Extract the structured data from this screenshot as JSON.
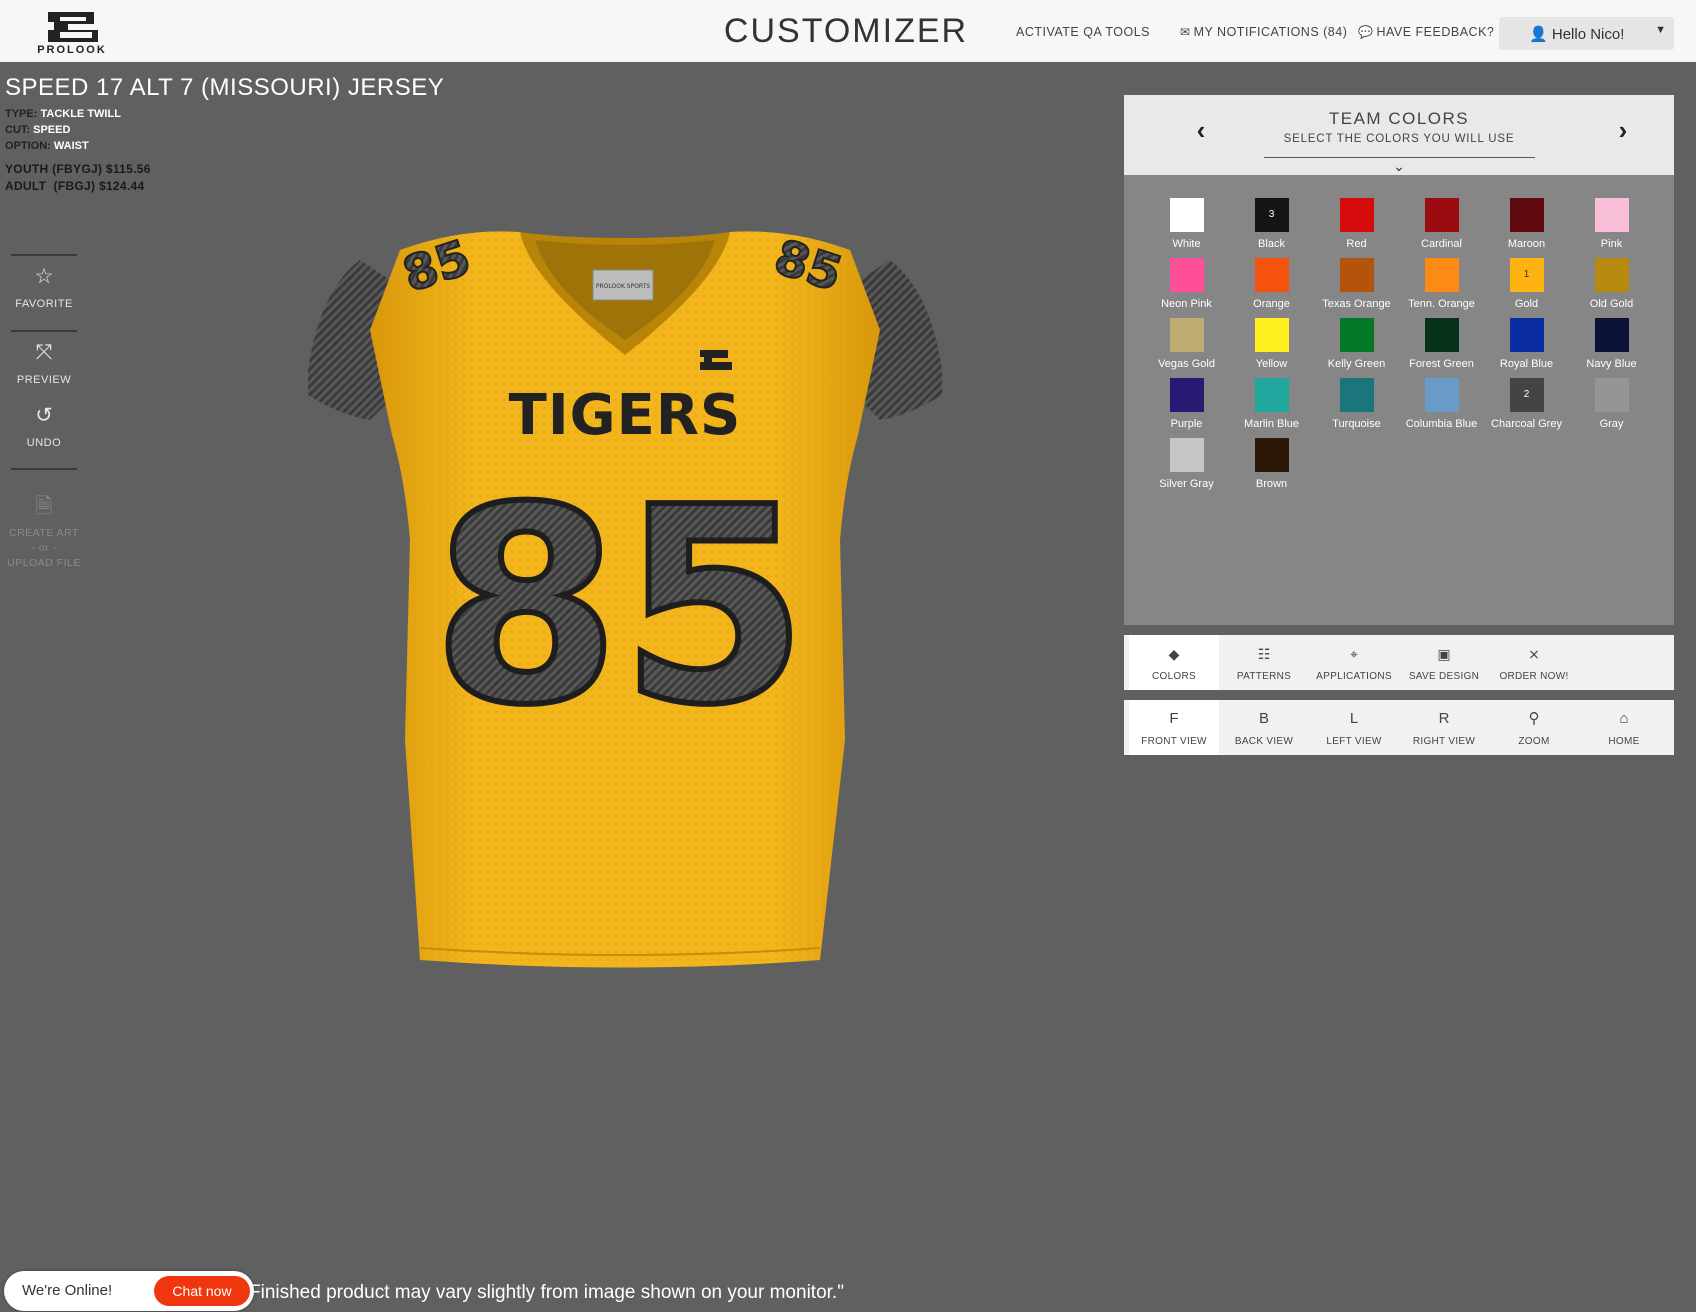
{
  "header": {
    "logo_text": "PROLOOK",
    "title": "CUSTOMIZER",
    "qa_tools": "ACTIVATE QA TOOLS",
    "notifications": "MY NOTIFICATIONS (84)",
    "feedback": "HAVE FEEDBACK?",
    "user_greeting": "Hello Nico!"
  },
  "product": {
    "title": "SPEED 17 ALT 7 (MISSOURI) JERSEY",
    "specs": [
      {
        "key": "TYPE:",
        "value": "TACKLE TWILL"
      },
      {
        "key": "CUT:",
        "value": "SPEED"
      },
      {
        "key": "OPTION:",
        "value": "WAIST"
      }
    ],
    "prices": [
      "YOUTH (FBYGJ) $115.56",
      "ADULT  (FBGJ) $124.44"
    ]
  },
  "tools": {
    "favorite": "FAVORITE",
    "preview": "PREVIEW",
    "undo": "UNDO",
    "create_art": "CREATE ART",
    "or": "- or -",
    "upload_file": "UPLOAD FILE"
  },
  "jersey": {
    "team_name": "TIGERS",
    "number": "85",
    "tag_text": "PROLOOK SPORTS",
    "colors": {
      "body": "#f2b51b",
      "trim": "#3c3c3c",
      "pattern": "#555555"
    }
  },
  "team_colors": {
    "title": "TEAM COLORS",
    "subtitle": "SELECT THE COLORS YOU WILL USE",
    "swatches": [
      {
        "name": "White",
        "color": "#ffffff",
        "badge": ""
      },
      {
        "name": "Black",
        "color": "#141414",
        "badge": "3"
      },
      {
        "name": "Red",
        "color": "#d50a0a",
        "badge": ""
      },
      {
        "name": "Cardinal",
        "color": "#9c0b10",
        "badge": ""
      },
      {
        "name": "Maroon",
        "color": "#5e0a0d",
        "badge": ""
      },
      {
        "name": "Pink",
        "color": "#f9bfd9",
        "badge": ""
      },
      {
        "name": "Neon Pink",
        "color": "#ff4f98",
        "badge": ""
      },
      {
        "name": "Orange",
        "color": "#f6520f",
        "badge": ""
      },
      {
        "name": "Texas Orange",
        "color": "#b4530c",
        "badge": ""
      },
      {
        "name": "Tenn. Orange",
        "color": "#fc8a14",
        "badge": ""
      },
      {
        "name": "Gold",
        "color": "#ffb312",
        "badge": "1"
      },
      {
        "name": "Old Gold",
        "color": "#b68a0e",
        "badge": ""
      },
      {
        "name": "Vegas Gold",
        "color": "#bfac72",
        "badge": ""
      },
      {
        "name": "Yellow",
        "color": "#fff01f",
        "badge": ""
      },
      {
        "name": "Kelly Green",
        "color": "#037827",
        "badge": ""
      },
      {
        "name": "Forest Green",
        "color": "#06321a",
        "badge": ""
      },
      {
        "name": "Royal Blue",
        "color": "#0a2ea2",
        "badge": ""
      },
      {
        "name": "Navy Blue",
        "color": "#0b1238",
        "badge": ""
      },
      {
        "name": "Purple",
        "color": "#271a73",
        "badge": ""
      },
      {
        "name": "Marlin Blue",
        "color": "#21a69d",
        "badge": ""
      },
      {
        "name": "Turquoise",
        "color": "#1a767b",
        "badge": ""
      },
      {
        "name": "Columbia Blue",
        "color": "#699bc9",
        "badge": ""
      },
      {
        "name": "Charcoal Grey",
        "color": "#444444",
        "badge": "2"
      },
      {
        "name": "Gray",
        "color": "#959595",
        "badge": ""
      },
      {
        "name": "Silver Gray",
        "color": "#c5c5c5",
        "badge": ""
      },
      {
        "name": "Brown",
        "color": "#2b1806",
        "badge": ""
      }
    ]
  },
  "tabs": [
    {
      "label": "COLORS",
      "icon": "drop-icon",
      "glyph": "◆"
    },
    {
      "label": "PATTERNS",
      "icon": "grid-icon",
      "glyph": "☷"
    },
    {
      "label": "APPLICATIONS",
      "icon": "map-pin-icon",
      "glyph": "⌖"
    },
    {
      "label": "SAVE DESIGN",
      "icon": "floppy-icon",
      "glyph": "▣"
    },
    {
      "label": "ORDER NOW!",
      "icon": "cart-icon",
      "glyph": "⨯"
    }
  ],
  "views": [
    {
      "label": "FRONT VIEW",
      "glyph": "F"
    },
    {
      "label": "BACK VIEW",
      "glyph": "B"
    },
    {
      "label": "LEFT VIEW",
      "glyph": "L"
    },
    {
      "label": "RIGHT VIEW",
      "glyph": "R"
    },
    {
      "label": "ZOOM",
      "glyph": "⚲"
    },
    {
      "label": "HOME",
      "glyph": "⌂"
    }
  ],
  "chat": {
    "status": "We're Online!",
    "button": "Chat now"
  },
  "disclaimer": "Finished product may vary slightly from image shown on your monitor.\""
}
